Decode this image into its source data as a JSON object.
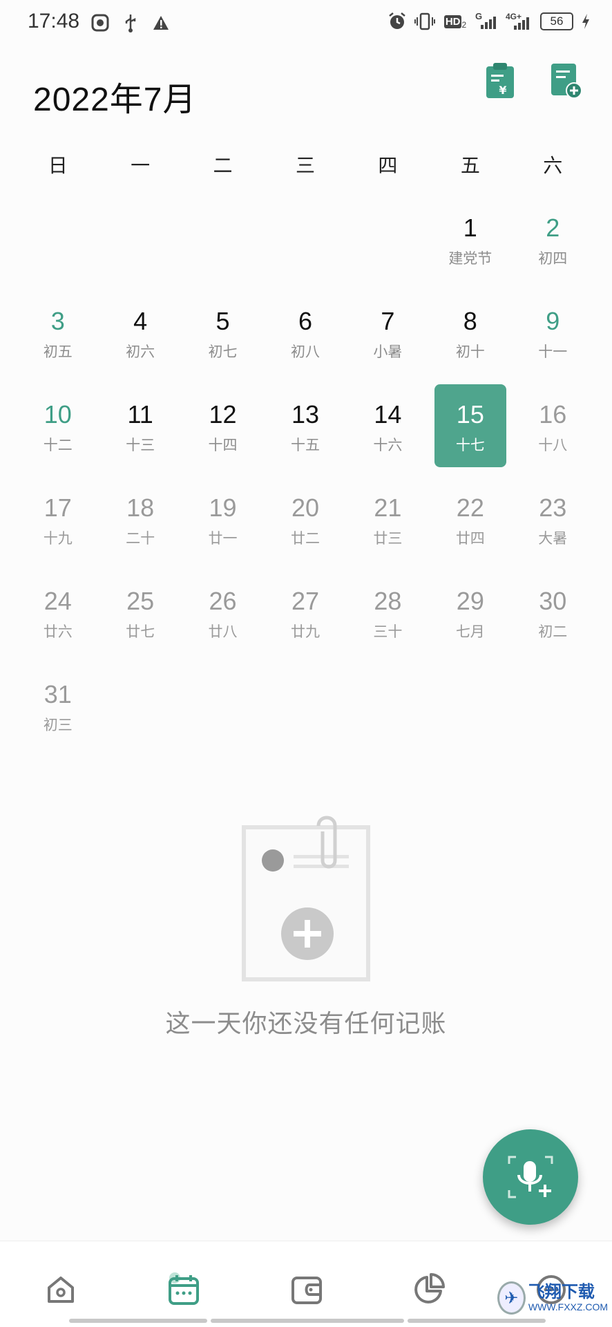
{
  "status_bar": {
    "time": "17:48",
    "network_top": "4G+",
    "signal_label": "G",
    "hd_label": "HD",
    "hd_sub": "2",
    "battery": "56"
  },
  "header": {
    "title": "2022年7月"
  },
  "weekdays": [
    "日",
    "一",
    "二",
    "三",
    "四",
    "五",
    "六"
  ],
  "calendar": {
    "leading_blanks": 5,
    "days": [
      {
        "num": "1",
        "lunar": "建党节",
        "style": "black"
      },
      {
        "num": "2",
        "lunar": "初四",
        "style": "green"
      },
      {
        "num": "3",
        "lunar": "初五",
        "style": "green"
      },
      {
        "num": "4",
        "lunar": "初六",
        "style": "black"
      },
      {
        "num": "5",
        "lunar": "初七",
        "style": "black"
      },
      {
        "num": "6",
        "lunar": "初八",
        "style": "black"
      },
      {
        "num": "7",
        "lunar": "小暑",
        "style": "black"
      },
      {
        "num": "8",
        "lunar": "初十",
        "style": "black"
      },
      {
        "num": "9",
        "lunar": "十一",
        "style": "green"
      },
      {
        "num": "10",
        "lunar": "十二",
        "style": "green"
      },
      {
        "num": "11",
        "lunar": "十三",
        "style": "black"
      },
      {
        "num": "12",
        "lunar": "十四",
        "style": "black"
      },
      {
        "num": "13",
        "lunar": "十五",
        "style": "black"
      },
      {
        "num": "14",
        "lunar": "十六",
        "style": "black"
      },
      {
        "num": "15",
        "lunar": "十七",
        "style": "selected"
      },
      {
        "num": "16",
        "lunar": "十八",
        "style": "future"
      },
      {
        "num": "17",
        "lunar": "十九",
        "style": "future"
      },
      {
        "num": "18",
        "lunar": "二十",
        "style": "future"
      },
      {
        "num": "19",
        "lunar": "廿一",
        "style": "future"
      },
      {
        "num": "20",
        "lunar": "廿二",
        "style": "future"
      },
      {
        "num": "21",
        "lunar": "廿三",
        "style": "future"
      },
      {
        "num": "22",
        "lunar": "廿四",
        "style": "future"
      },
      {
        "num": "23",
        "lunar": "大暑",
        "style": "future"
      },
      {
        "num": "24",
        "lunar": "廿六",
        "style": "future"
      },
      {
        "num": "25",
        "lunar": "廿七",
        "style": "future"
      },
      {
        "num": "26",
        "lunar": "廿八",
        "style": "future"
      },
      {
        "num": "27",
        "lunar": "廿九",
        "style": "future"
      },
      {
        "num": "28",
        "lunar": "三十",
        "style": "future"
      },
      {
        "num": "29",
        "lunar": "七月",
        "style": "future"
      },
      {
        "num": "30",
        "lunar": "初二",
        "style": "future"
      },
      {
        "num": "31",
        "lunar": "初三",
        "style": "future"
      }
    ]
  },
  "empty_state": {
    "message": "这一天你还没有任何记账"
  },
  "bottom_nav": {
    "items": [
      {
        "icon": "home-icon"
      },
      {
        "icon": "calendar-icon",
        "active": true
      },
      {
        "icon": "wallet-icon"
      },
      {
        "icon": "pie-chart-icon"
      },
      {
        "icon": "more-icon"
      }
    ]
  },
  "watermark": {
    "title": "飞翔下载",
    "url": "WWW.FXXZ.COM"
  },
  "colors": {
    "accent": "#3f9e86",
    "selected_bg": "#4fa58d",
    "future_text": "#9a9a9a"
  }
}
